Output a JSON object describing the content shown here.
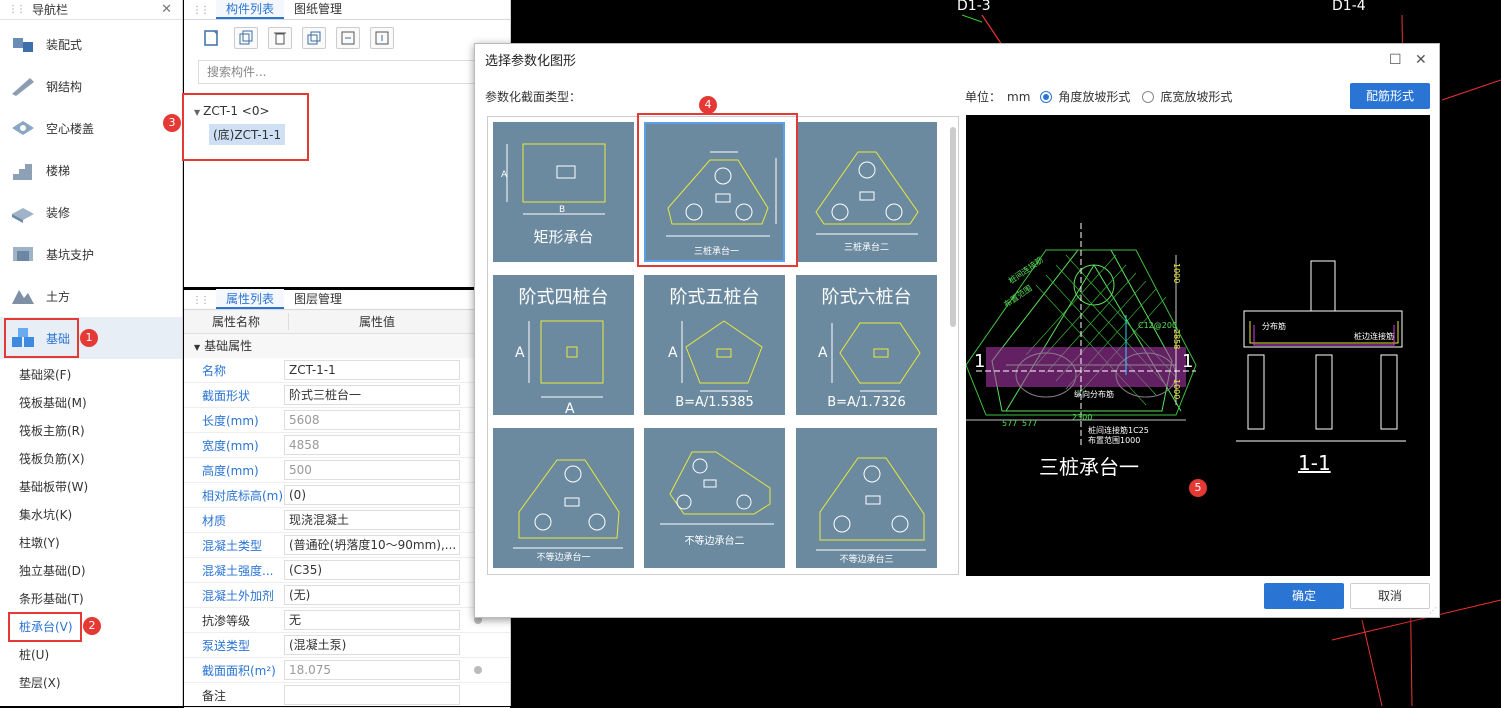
{
  "nav": {
    "title": "导航栏",
    "items": [
      {
        "label": "装配式",
        "icon": "prefab-icon"
      },
      {
        "label": "钢结构",
        "icon": "steel-icon"
      },
      {
        "label": "空心楼盖",
        "icon": "hollow-floor-icon"
      },
      {
        "label": "楼梯",
        "icon": "stairs-icon"
      },
      {
        "label": "装修",
        "icon": "decoration-icon"
      },
      {
        "label": "基坑支护",
        "icon": "pit-support-icon"
      },
      {
        "label": "土方",
        "icon": "earthwork-icon"
      },
      {
        "label": "基础",
        "icon": "foundation-icon"
      }
    ],
    "sub_items": [
      "基础梁(F)",
      "筏板基础(M)",
      "筏板主筋(R)",
      "筏板负筋(X)",
      "基础板带(W)",
      "集水坑(K)",
      "柱墩(Y)",
      "独立基础(D)",
      "条形基础(T)",
      "桩承台(V)",
      "桩(U)",
      "垫层(X)"
    ]
  },
  "components": {
    "tabs": [
      "构件列表",
      "图纸管理"
    ],
    "search_placeholder": "搜索构件...",
    "tree_root": "ZCT-1 <0>",
    "tree_child": "(底)ZCT-1-1"
  },
  "properties": {
    "tabs": [
      "属性列表",
      "图层管理"
    ],
    "col_name": "属性名称",
    "col_value": "属性值",
    "group": "基础属性",
    "rows": [
      {
        "k": "名称",
        "v": "ZCT-1-1"
      },
      {
        "k": "截面形状",
        "v": "阶式三桩台一"
      },
      {
        "k": "长度(mm)",
        "v": "5608"
      },
      {
        "k": "宽度(mm)",
        "v": "4858"
      },
      {
        "k": "高度(mm)",
        "v": "500"
      },
      {
        "k": "相对底标高(m)",
        "v": "(0)"
      },
      {
        "k": "材质",
        "v": "现浇混凝土"
      },
      {
        "k": "混凝土类型",
        "v": "(普通砼(坍落度10～90mm),..."
      },
      {
        "k": "混凝土强度...",
        "v": "(C35)"
      },
      {
        "k": "混凝土外加剂",
        "v": "(无)"
      },
      {
        "k": "抗渗等级",
        "v": "无"
      },
      {
        "k": "泵送类型",
        "v": "(混凝土泵)"
      },
      {
        "k": "截面面积(m²)",
        "v": "18.075"
      },
      {
        "k": "备注",
        "v": ""
      }
    ]
  },
  "cad": {
    "labels": [
      "D1-3",
      "D1-4"
    ]
  },
  "dialog": {
    "title": "选择参数化图形",
    "type_label": "参数化截面类型：",
    "unit_label": "单位：",
    "unit": "mm",
    "radio1": "角度放坡形式",
    "radio2": "底宽放坡形式",
    "rebar_button": "配筋形式",
    "ok": "确定",
    "cancel": "取消",
    "tiles": [
      {
        "label": "矩形承台"
      },
      {
        "label": "三桩承台一"
      },
      {
        "label": "三桩承台二"
      },
      {
        "title": "阶式四桩台",
        "note": ""
      },
      {
        "title": "阶式五桩台",
        "note": "B=A/1.5385"
      },
      {
        "title": "阶式六桩台",
        "note": "B=A/1.7326"
      },
      {
        "label": "不等边承台一"
      },
      {
        "label": "不等边承台二"
      },
      {
        "label": "不等边承台三"
      }
    ],
    "preview": {
      "main_label": "三桩承台一",
      "section_label": "1-1",
      "left_mark": "1",
      "right_mark": "1",
      "dims": [
        "577",
        "577",
        "2300",
        "1000",
        "2858",
        "1000"
      ],
      "notes": [
        "桩间连接筋",
        "布置范围",
        "纵向分布筋",
        "C12@200",
        "分布筋",
        "桩间连接筋1C25",
        "布置范围1000",
        "桩边连接筋"
      ]
    }
  },
  "badges": [
    "1",
    "2",
    "3",
    "4",
    "5"
  ]
}
